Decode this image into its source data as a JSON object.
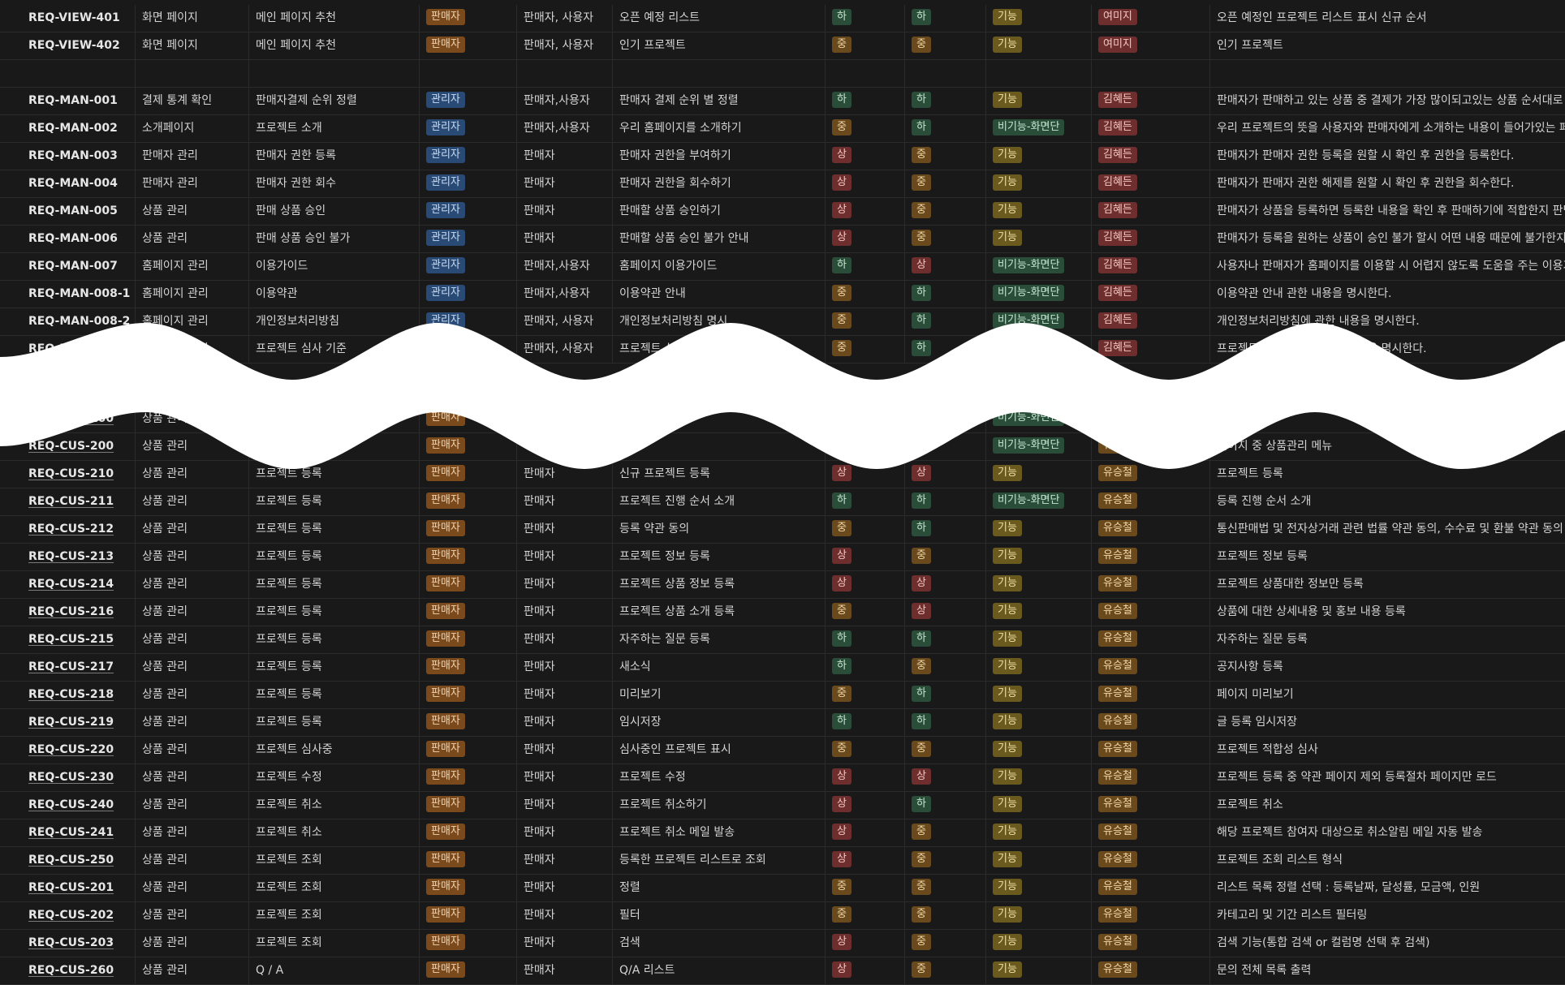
{
  "rows_top": [
    {
      "id": "REQ-VIEW-401",
      "cat": "화면 페이지",
      "sub": "메인 페이지 추천",
      "role": "판매자",
      "target": "판매자, 사용자",
      "name": "오픈 예정 리스트",
      "pri": "하",
      "diff": "하",
      "type": "기능",
      "owner": "여미지",
      "desc": "오픈 예정인 프로젝트 리스트 표시 신규 순서"
    },
    {
      "id": "REQ-VIEW-402",
      "cat": "화면 페이지",
      "sub": "메인 페이지 추천",
      "role": "판매자",
      "target": "판매자, 사용자",
      "name": "인기 프로젝트",
      "pri": "중",
      "diff": "중",
      "type": "기능",
      "owner": "여미지",
      "desc": "인기 프로젝트"
    },
    {
      "id": "",
      "cat": "",
      "sub": "",
      "role": "",
      "target": "",
      "name": "",
      "pri": "",
      "diff": "",
      "type": "",
      "owner": "",
      "desc": ""
    },
    {
      "id": "REQ-MAN-001",
      "cat": "결제 통계 확인",
      "sub": "판매자결제 순위 정렬",
      "role": "관리자",
      "target": "판매자,사용자",
      "name": "판매자 결제 순위 별 정렬",
      "pri": "하",
      "diff": "하",
      "type": "기능",
      "owner": "김혜든",
      "desc": "판매자가 판매하고 있는 상품 중 결제가 가장 많이되고있는 상품 순서대로 정렬합"
    },
    {
      "id": "REQ-MAN-002",
      "cat": "소개페이지",
      "sub": "프로젝트 소개",
      "role": "관리자",
      "target": "판매자,사용자",
      "name": "우리 홈페이지를 소개하기",
      "pri": "중",
      "diff": "하",
      "type": "비기능-화면단",
      "owner": "김혜든",
      "desc": "우리 프로젝트의 뜻을 사용자와 판매자에게 소개하는 내용이 들어가있는 페이지"
    },
    {
      "id": "REQ-MAN-003",
      "cat": "판매자 관리",
      "sub": "판매자 권한 등록",
      "role": "관리자",
      "target": "판매자",
      "name": "판매자 권한을 부여하기",
      "pri": "상",
      "diff": "중",
      "type": "기능",
      "owner": "김혜든",
      "desc": "판매자가 판매자 권한 등록을 원할 시 확인 후 권한을 등록한다."
    },
    {
      "id": "REQ-MAN-004",
      "cat": "판매자 관리",
      "sub": "판매자 권한 회수",
      "role": "관리자",
      "target": "판매자",
      "name": "판매자 권한을 회수하기",
      "pri": "상",
      "diff": "중",
      "type": "기능",
      "owner": "김혜든",
      "desc": "판매자가 판매자 권한 해제를 원할 시 확인 후 권한을 회수한다."
    },
    {
      "id": "REQ-MAN-005",
      "cat": "상품 관리",
      "sub": "판매 상품 승인",
      "role": "관리자",
      "target": "판매자",
      "name": "판매할 상품 승인하기",
      "pri": "상",
      "diff": "중",
      "type": "기능",
      "owner": "김혜든",
      "desc": "판매자가 상품을 등록하면 등록한 내용을 확인 후 판매하기에 적합한지 판단하여"
    },
    {
      "id": "REQ-MAN-006",
      "cat": "상품 관리",
      "sub": "판매 상품 승인 불가",
      "role": "관리자",
      "target": "판매자",
      "name": "판매할 상품 승인 불가 안내",
      "pri": "상",
      "diff": "중",
      "type": "기능",
      "owner": "김혜든",
      "desc": "판매자가 등록을 원하는 상품이 승인 불가 할시 어떤 내용 때문에 불가한지 판매"
    },
    {
      "id": "REQ-MAN-007",
      "cat": "홈페이지 관리",
      "sub": "이용가이드",
      "role": "관리자",
      "target": "판매자,사용자",
      "name": "홈페이지 이용가이드",
      "pri": "하",
      "diff": "상",
      "type": "비기능-화면단",
      "owner": "김혜든",
      "desc": "사용자나 판매자가 홈페이지를 이용할 시 어렵지 않도록 도움을 주는 이용가이드"
    },
    {
      "id": "REQ-MAN-008-1",
      "cat": "홈페이지 관리",
      "sub": "이용약관",
      "role": "관리자",
      "target": "판매자,사용자",
      "name": " 이용약관 안내",
      "pri": "중",
      "diff": "하",
      "type": "비기능-화면단",
      "owner": "김혜든",
      "desc": " 이용약관 안내 관한 내용을 명시한다."
    },
    {
      "id": "REQ-MAN-008-2",
      "cat": "홈페이지 관리",
      "sub": "개인정보처리방침",
      "role": "관리자",
      "target": "판매자, 사용자",
      "name": "개인정보처리방침 명시",
      "pri": "중",
      "diff": "하",
      "type": "비기능-화면단",
      "owner": "김혜든",
      "desc": "개인정보처리방침에 관한 내용을 명시한다."
    },
    {
      "id": "REQ-MAN-009",
      "cat": "홈페이지 관리",
      "sub": "프로젝트 심사 기준",
      "role": "관리자",
      "target": "판매자, 사용자",
      "name": "프로젝트 심사 기준",
      "pri": "중",
      "diff": "하",
      "type": "비기능-화면단",
      "owner": "김혜든",
      "desc": "프로젝트 심사 기준에 관한 내용을 명시한다."
    }
  ],
  "rows_bottom": [
    {
      "id": "REQ-CUS-100",
      "cat": "상품 관리",
      "sub": "",
      "role": "판매자",
      "target": "",
      "name": "",
      "pri": "",
      "diff": "",
      "type": "비기능-화면단",
      "owner": "",
      "desc": ""
    },
    {
      "id": "REQ-CUS-200",
      "cat": "상품 관리",
      "sub": "",
      "role": "판매자",
      "target": "",
      "name": "",
      "pri": "",
      "diff": "",
      "type": "비기능-화면단",
      "owner": "유승철",
      "desc": "페이지 중 상품관리 메뉴"
    },
    {
      "id": "REQ-CUS-210",
      "cat": "상품 관리",
      "sub": "프로젝트 등록",
      "role": "판매자",
      "target": "판매자",
      "name": "신규 프로젝트 등록",
      "pri": "상",
      "diff": "상",
      "type": "기능",
      "owner": "유승철",
      "desc": "프로젝트 등록"
    },
    {
      "id": "REQ-CUS-211",
      "cat": "상품 관리",
      "sub": "프로젝트 등록",
      "role": "판매자",
      "target": "판매자",
      "name": "프로젝트  진행 순서 소개",
      "pri": "하",
      "diff": "하",
      "type": "비기능-화면단",
      "owner": "유승철",
      "desc": "등록 진행 순서 소개"
    },
    {
      "id": "REQ-CUS-212",
      "cat": "상품 관리",
      "sub": "프로젝트 등록",
      "role": "판매자",
      "target": "판매자",
      "name": "등록 약관 동의",
      "pri": "중",
      "diff": "하",
      "type": "기능",
      "owner": "유승철",
      "desc": "통신판매법 및 전자상거래 관련 법률 약관 동의, 수수료 및 환불 약관 동의"
    },
    {
      "id": "REQ-CUS-213",
      "cat": "상품 관리",
      "sub": "프로젝트 등록",
      "role": "판매자",
      "target": "판매자",
      "name": "프로젝트 정보 등록",
      "pri": "상",
      "diff": "중",
      "type": "기능",
      "owner": "유승철",
      "desc": "프로젝트 정보 등록"
    },
    {
      "id": "REQ-CUS-214",
      "cat": "상품 관리",
      "sub": "프로젝트 등록",
      "role": "판매자",
      "target": "판매자",
      "name": "프로젝트 상품 정보 등록",
      "pri": "상",
      "diff": "상",
      "type": "기능",
      "owner": "유승철",
      "desc": "프로젝트 상품대한 정보만 등록"
    },
    {
      "id": "REQ-CUS-216",
      "cat": "상품 관리",
      "sub": "프로젝트 등록",
      "role": "판매자",
      "target": "판매자",
      "name": "프로젝트 상품 소개 등록",
      "pri": "중",
      "diff": "상",
      "type": "기능",
      "owner": "유승철",
      "desc": "상품에 대한 상세내용 및 홍보 내용 등록"
    },
    {
      "id": "REQ-CUS-215",
      "cat": "상품 관리",
      "sub": "프로젝트 등록",
      "role": "판매자",
      "target": "판매자",
      "name": "자주하는 질문 등록",
      "pri": "하",
      "diff": "하",
      "type": "기능",
      "owner": "유승철",
      "desc": "자주하는 질문 등록"
    },
    {
      "id": "REQ-CUS-217",
      "cat": "상품 관리",
      "sub": "프로젝트 등록",
      "role": "판매자",
      "target": "판매자",
      "name": "새소식",
      "pri": "하",
      "diff": "중",
      "type": "기능",
      "owner": "유승철",
      "desc": "공지사항 등록"
    },
    {
      "id": "REQ-CUS-218",
      "cat": "상품 관리",
      "sub": "프로젝트 등록",
      "role": "판매자",
      "target": "판매자",
      "name": "미리보기",
      "pri": "중",
      "diff": "하",
      "type": "기능",
      "owner": "유승철",
      "desc": "페이지 미리보기"
    },
    {
      "id": "REQ-CUS-219",
      "cat": "상품 관리",
      "sub": "프로젝트 등록",
      "role": "판매자",
      "target": "판매자",
      "name": "임시저장",
      "pri": "하",
      "diff": "하",
      "type": "기능",
      "owner": "유승철",
      "desc": "글 등록 임시저장"
    },
    {
      "id": "REQ-CUS-220",
      "cat": "상품 관리",
      "sub": "프로젝트 심사중",
      "role": "판매자",
      "target": "판매자",
      "name": "심사중인 프로젝트 표시",
      "pri": "중",
      "diff": "중",
      "type": "기능",
      "owner": "유승철",
      "desc": "프로젝트 적합성 심사"
    },
    {
      "id": "REQ-CUS-230",
      "cat": "상품 관리",
      "sub": "프로젝트 수정",
      "role": "판매자",
      "target": "판매자",
      "name": "프로젝트 수정",
      "pri": "상",
      "diff": "상",
      "type": "기능",
      "owner": "유승철",
      "desc": "프로젝트 등록 중 약관 페이지 제외 등록절차 페이지만 로드"
    },
    {
      "id": "REQ-CUS-240",
      "cat": "상품 관리",
      "sub": "프로젝트 취소",
      "role": "판매자",
      "target": "판매자",
      "name": "프로젝트 취소하기",
      "pri": "상",
      "diff": "하",
      "type": "기능",
      "owner": "유승철",
      "desc": "프로젝트 취소"
    },
    {
      "id": "REQ-CUS-241",
      "cat": "상품 관리",
      "sub": "프로젝트 취소",
      "role": "판매자",
      "target": "판매자",
      "name": "프로젝트 취소 메일 발송",
      "pri": "상",
      "diff": "중",
      "type": "기능",
      "owner": "유승철",
      "desc": "해당 프로젝트 참여자 대상으로 취소알림 메일 자동 발송"
    },
    {
      "id": "REQ-CUS-250",
      "cat": "상품 관리",
      "sub": "프로젝트 조회",
      "role": "판매자",
      "target": "판매자",
      "name": "등록한 프로젝트 리스트로 조회",
      "pri": "상",
      "diff": "중",
      "type": "기능",
      "owner": "유승철",
      "desc": "프로젝트 조회 리스트 형식"
    },
    {
      "id": "REQ-CUS-201",
      "cat": "상품 관리",
      "sub": "프로젝트 조회",
      "role": "판매자",
      "target": "판매자",
      "name": "정렬",
      "pri": "중",
      "diff": "중",
      "type": "기능",
      "owner": "유승철",
      "desc": "리스트 목록 정렬 선택 :  등록날짜, 달성률, 모금액, 인원"
    },
    {
      "id": "REQ-CUS-202",
      "cat": "상품 관리",
      "sub": "프로젝트 조회",
      "role": "판매자",
      "target": "판매자",
      "name": "필터",
      "pri": "중",
      "diff": "중",
      "type": "기능",
      "owner": "유승철",
      "desc": "카테고리 및 기간 리스트 필터링"
    },
    {
      "id": "REQ-CUS-203",
      "cat": "상품 관리",
      "sub": "프로젝트 조회",
      "role": "판매자",
      "target": "판매자",
      "name": "검색",
      "pri": "상",
      "diff": "중",
      "type": "기능",
      "owner": "유승철",
      "desc": "검색 기능(통합 검색 or 컬럼명 선택 후 검색)"
    },
    {
      "id": "REQ-CUS-260",
      "cat": "상품 관리",
      "sub": "Q / A",
      "role": "판매자",
      "target": "판매자",
      "name": "Q/A 리스트",
      "pri": "상",
      "diff": "중",
      "type": "기능",
      "owner": "유승철",
      "desc": "문의 전체 목록 출력"
    }
  ],
  "colors": {
    "bg": "#191919",
    "border": "#2b2b2b",
    "tear": "#ffffff"
  }
}
